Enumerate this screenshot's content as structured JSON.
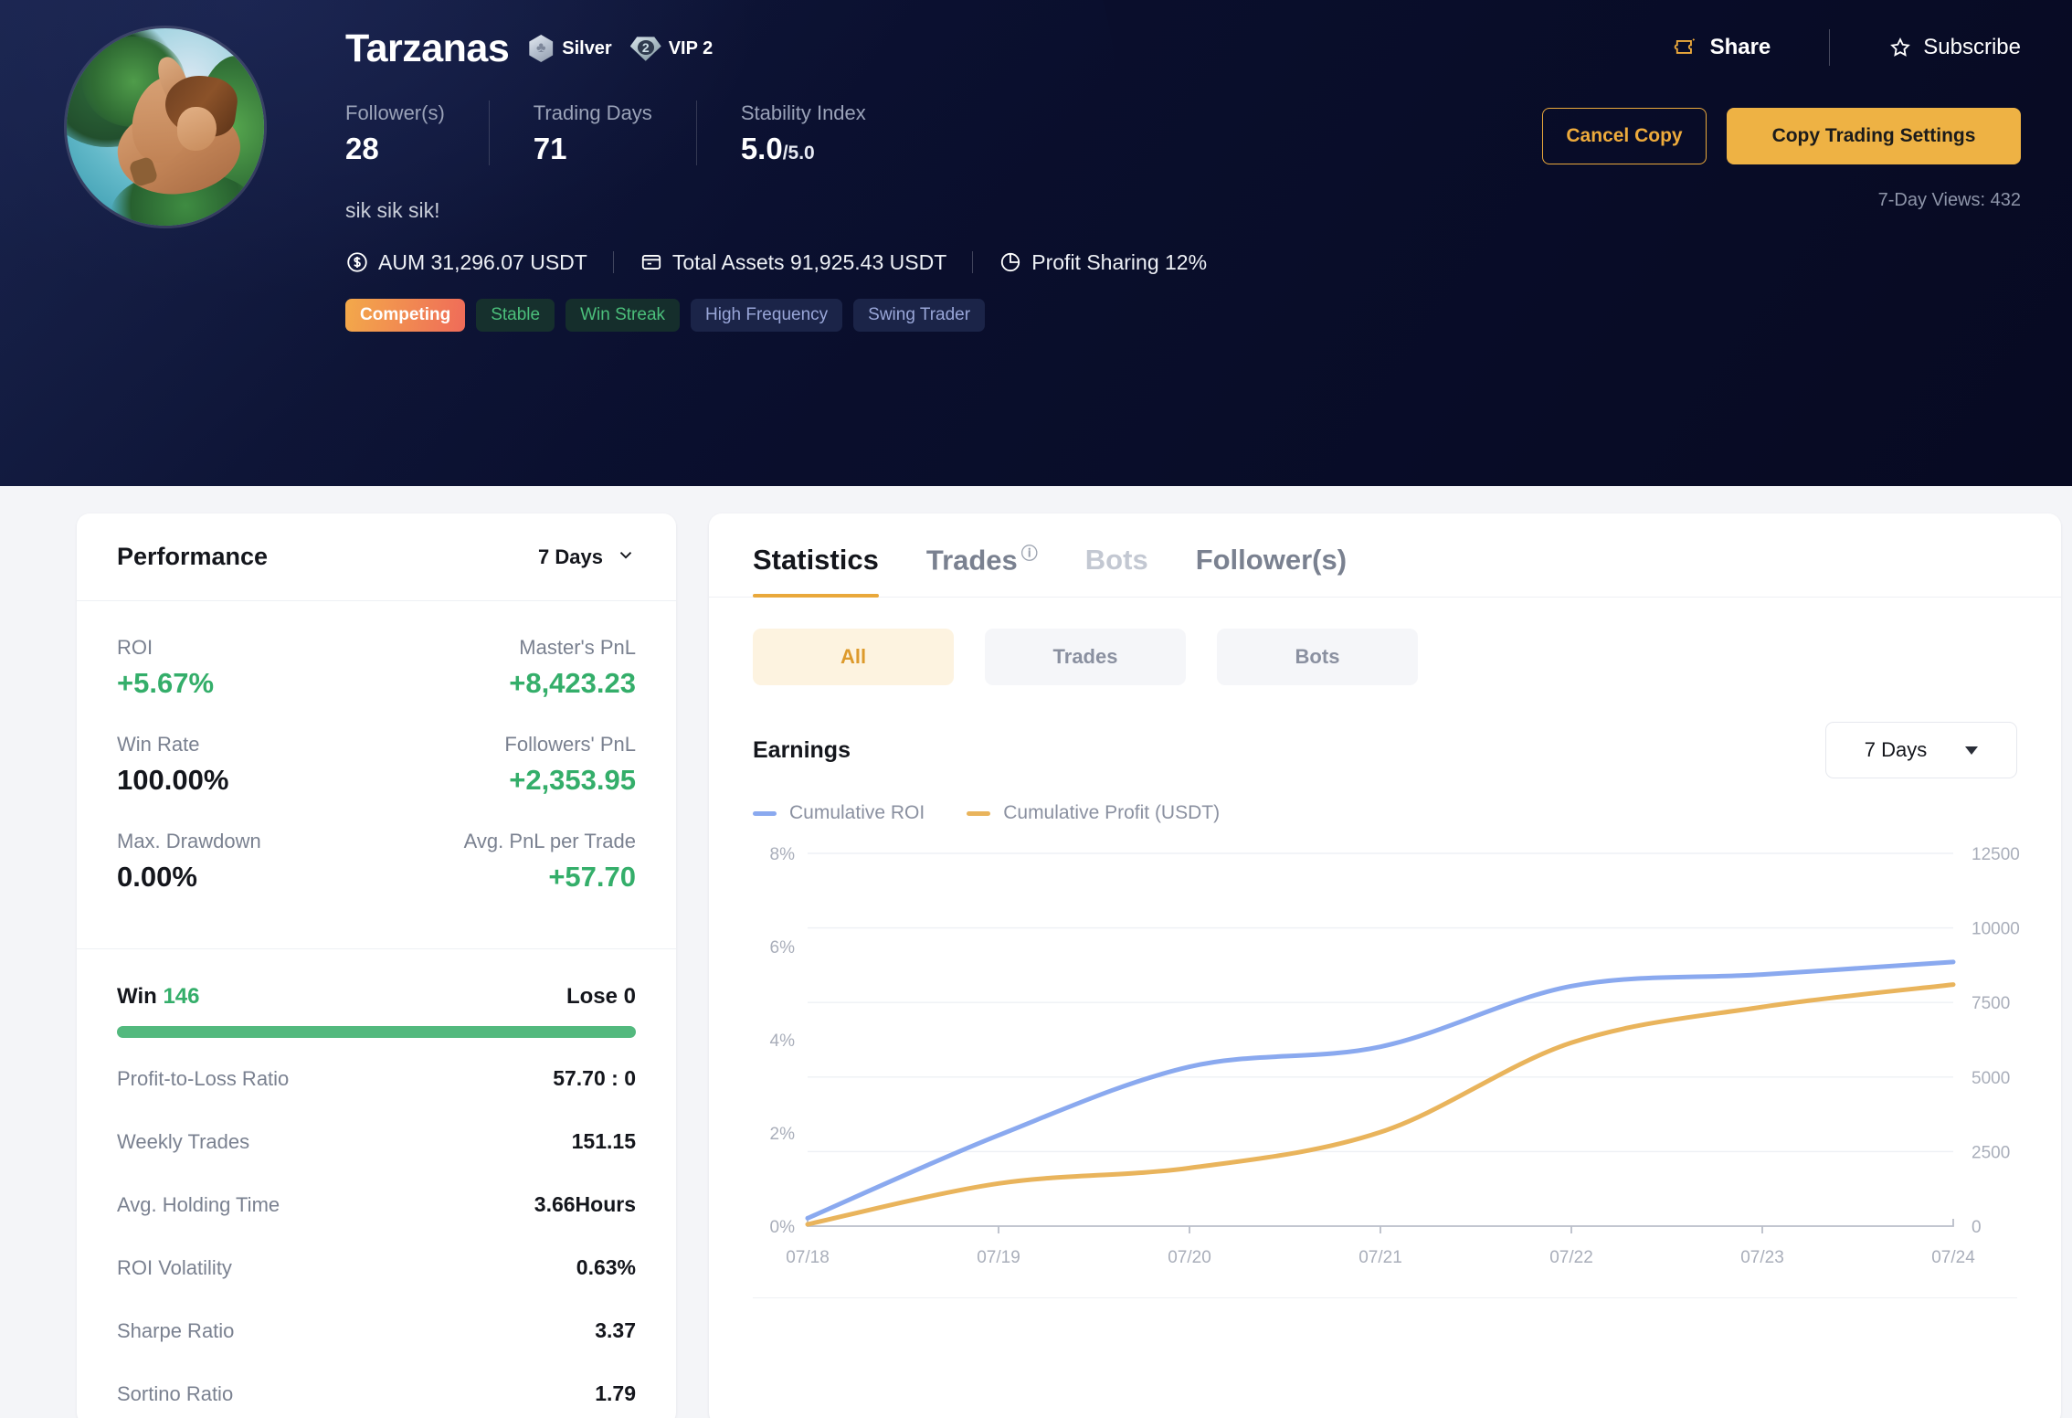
{
  "header": {
    "username": "Tarzanas",
    "tier_badge": {
      "label": "Silver",
      "icon": "clover-hex-icon"
    },
    "vip_badge": {
      "label": "VIP 2",
      "level": "2",
      "icon": "diamond-icon"
    },
    "stats": [
      {
        "label": "Follower(s)",
        "value": "28"
      },
      {
        "label": "Trading Days",
        "value": "71"
      },
      {
        "label": "Stability Index",
        "value": "5.0",
        "suffix": "/5.0"
      }
    ],
    "tagline": "sik sik sik!",
    "meta": [
      {
        "icon": "dollar-circle-icon",
        "text": "AUM 31,296.07 USDT"
      },
      {
        "icon": "wallet-icon",
        "text": "Total Assets 91,925.43 USDT"
      },
      {
        "icon": "pie-chart-icon",
        "text": "Profit Sharing 12%"
      }
    ],
    "tags": [
      "Competing",
      "Stable",
      "Win Streak",
      "High Frequency",
      "Swing Trader"
    ],
    "share_label": "Share",
    "subscribe_label": "Subscribe",
    "cancel_copy_label": "Cancel Copy",
    "copy_settings_label": "Copy Trading Settings",
    "views_label": "7-Day Views: 432"
  },
  "performance": {
    "title": "Performance",
    "period": "7 Days",
    "kpis": [
      {
        "label": "ROI",
        "value": "+5.67%",
        "positive": true
      },
      {
        "label": "Master's PnL",
        "value": "+8,423.23",
        "positive": true
      },
      {
        "label": "Win Rate",
        "value": "100.00%",
        "positive": false
      },
      {
        "label": "Followers' PnL",
        "value": "+2,353.95",
        "positive": true
      },
      {
        "label": "Max. Drawdown",
        "value": "0.00%",
        "positive": false
      },
      {
        "label": "Avg. PnL per Trade",
        "value": "+57.70",
        "positive": true
      }
    ],
    "win_label": "Win",
    "win_value": "146",
    "lose_label": "Lose 0",
    "win_ratio_percent": 100,
    "rows": [
      {
        "label": "Profit-to-Loss Ratio",
        "value": "57.70 : 0"
      },
      {
        "label": "Weekly Trades",
        "value": "151.15"
      },
      {
        "label": "Avg. Holding Time",
        "value": "3.66Hours"
      },
      {
        "label": "ROI Volatility",
        "value": "0.63%"
      },
      {
        "label": "Sharpe Ratio",
        "value": "3.37"
      },
      {
        "label": "Sortino Ratio",
        "value": "1.79"
      }
    ]
  },
  "main": {
    "tabs": [
      {
        "label": "Statistics",
        "state": "active"
      },
      {
        "label": "Trades",
        "state": "normal",
        "help": true
      },
      {
        "label": "Bots",
        "state": "muted"
      },
      {
        "label": "Follower(s)",
        "state": "normal"
      }
    ],
    "segments": [
      {
        "label": "All",
        "selected": true
      },
      {
        "label": "Trades",
        "selected": false
      },
      {
        "label": "Bots",
        "selected": false
      }
    ],
    "earnings_title": "Earnings",
    "earnings_period": "7 Days"
  },
  "colors": {
    "roi_line": "#8aa9ef",
    "profit_line": "#e9b45c",
    "accent": "#e9a83b",
    "positive": "#34ae6a",
    "hero_bg": "#0a0f2e"
  },
  "chart_data": {
    "type": "line",
    "title": "Earnings",
    "x": [
      "07/18",
      "07/19",
      "07/20",
      "07/21",
      "07/22",
      "07/23",
      "07/24"
    ],
    "xlabel": "",
    "grid": true,
    "legend_position": "top-left",
    "series": [
      {
        "name": "Cumulative ROI",
        "color": "#8aa9ef",
        "axis": "left",
        "unit": "%",
        "values": [
          0.17,
          1.95,
          3.42,
          3.85,
          5.15,
          5.4,
          5.67
        ]
      },
      {
        "name": "Cumulative Profit (USDT)",
        "color": "#e9b45c",
        "axis": "right",
        "unit": "USDT",
        "values": [
          60,
          1430,
          1950,
          3150,
          6150,
          7350,
          8100
        ]
      }
    ],
    "left_axis": {
      "label": "Cumulative ROI",
      "ticks": [
        "0%",
        "2%",
        "4%",
        "6%",
        "8%"
      ],
      "tick_values": [
        0,
        2,
        4,
        6,
        8
      ],
      "range": [
        0,
        8
      ]
    },
    "right_axis": {
      "label": "Cumulative Profit (USDT)",
      "ticks": [
        "0",
        "2500",
        "5000",
        "7500",
        "10000",
        "12500"
      ],
      "tick_values": [
        0,
        2500,
        5000,
        7500,
        10000,
        12500
      ],
      "range": [
        0,
        12500
      ]
    }
  }
}
